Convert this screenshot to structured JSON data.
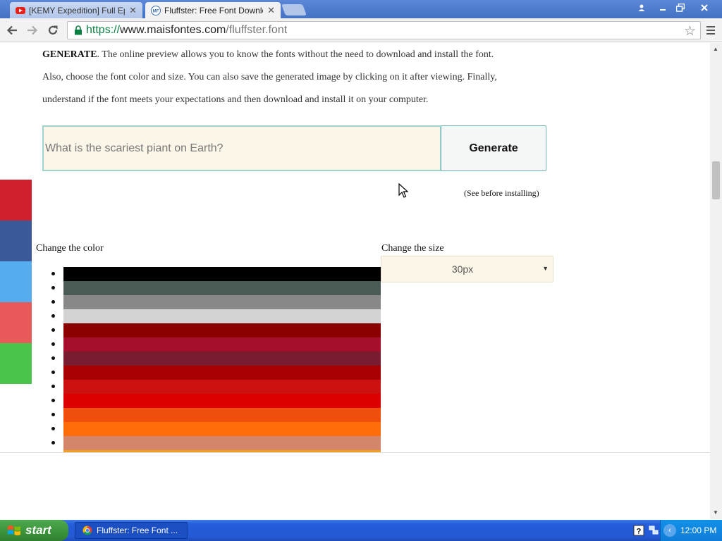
{
  "browser": {
    "tabs": [
      {
        "title": "[KEMY Expedition] Full Episo",
        "favicon": "youtube-icon",
        "active": false
      },
      {
        "title": "Fluffster: Free Font Downloa",
        "favicon": "maisfontes-icon",
        "active": true
      }
    ],
    "close_glyph": "✕",
    "url": {
      "scheme": "https://",
      "host": "www.maisfontes.com",
      "path": "/fluffster.font"
    }
  },
  "page": {
    "intro_lines": [
      {
        "bold": "GENERATE",
        "text": ". The online preview allows you to know the fonts without the need to download and install the font."
      },
      {
        "bold": "",
        "text": "Also, choose the font color and size. You can also save the generated image by clicking on it after viewing. Finally,"
      },
      {
        "bold": "",
        "text": "understand if the font meets your expectations and then download and install it on your computer."
      }
    ],
    "preview_input": {
      "value": "What is the scariest piant on Earth?"
    },
    "generate_label": "Generate",
    "see_before_note": "(See before installing)",
    "color_label": "Change the color",
    "size_label": "Change the size",
    "size_select": {
      "selected": "30px"
    },
    "color_swatches": [
      "#000000",
      "#4a5a55",
      "#888888",
      "#d3d3d3",
      "#8b0000",
      "#a50f2b",
      "#7a1c2f",
      "#a80000",
      "#cc1111",
      "#dd0000",
      "#f04e0c",
      "#ff6d0a",
      "#d4866a",
      "#f0a020"
    ],
    "share_buttons": [
      {
        "name": "share-red-button",
        "color": "#d0202e"
      },
      {
        "name": "share-facebook-button",
        "color": "#3b5998"
      },
      {
        "name": "share-twitter-button",
        "color": "#55acee"
      },
      {
        "name": "share-pink-button",
        "color": "#e85a5a"
      },
      {
        "name": "share-whatsapp-button",
        "color": "#4ac44a"
      }
    ]
  },
  "taskbar": {
    "start_label": "start",
    "task_item_label": "Fluffster: Free Font ...",
    "clock": "12:00 PM"
  }
}
